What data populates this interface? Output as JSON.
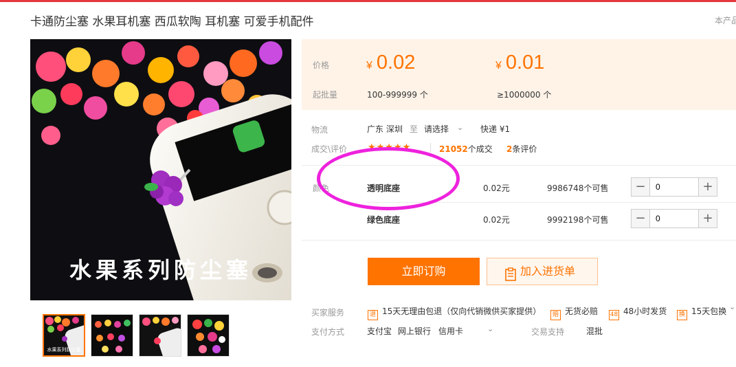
{
  "title": "卡通防尘塞 水果耳机塞 西瓜软陶 耳机塞 可爱手机配件",
  "header_note": "本产品",
  "image_caption": "水果系列防尘塞",
  "thumb_caption": "水果系列防尘塞",
  "price": {
    "label": "价格",
    "currency": "¥",
    "tier1_price": "0.02",
    "tier2_price": "0.01",
    "moq_label": "起批量",
    "tier1_range": "100-999999 个",
    "tier2_range": "≥1000000 个"
  },
  "logistics": {
    "label": "物流",
    "from": "广东 深圳",
    "to": "至",
    "select": "请选择",
    "express": "快递 ¥1"
  },
  "trade": {
    "label": "成交\\评价",
    "deals_count": "21052",
    "deals_suffix": "个成交",
    "reviews_count": "2",
    "reviews_suffix": "条评价"
  },
  "color_label": "颜色",
  "variants": [
    {
      "name": "透明底座",
      "price": "0.02元",
      "stock": "9986748个可售",
      "qty": "0"
    },
    {
      "name": "绿色底座",
      "price": "0.02元",
      "stock": "9992198个可售",
      "qty": "0"
    }
  ],
  "buttons": {
    "buy": "立即订购",
    "cart": "加入进货单"
  },
  "services": {
    "label": "买家服务",
    "items": [
      {
        "icon": "return-icon",
        "glyph": "退",
        "text": "15天无理由包退（仅向代销微供买家提供）"
      },
      {
        "icon": "compensate-icon",
        "glyph": "赔",
        "text": "无货必赔"
      },
      {
        "icon": "ship48-icon",
        "glyph": "48",
        "text": "48小时发货"
      },
      {
        "icon": "exchange-icon",
        "glyph": "换",
        "text": "15天包换"
      }
    ]
  },
  "payment": {
    "label": "支付方式",
    "methods": [
      "支付宝",
      "网上银行",
      "信用卡"
    ],
    "support_label": "交易支持",
    "support_value": "混批"
  },
  "colors": {
    "accent": "#ff7300",
    "price_bg": "#fff3e8",
    "annotation": "#ee22dd"
  }
}
